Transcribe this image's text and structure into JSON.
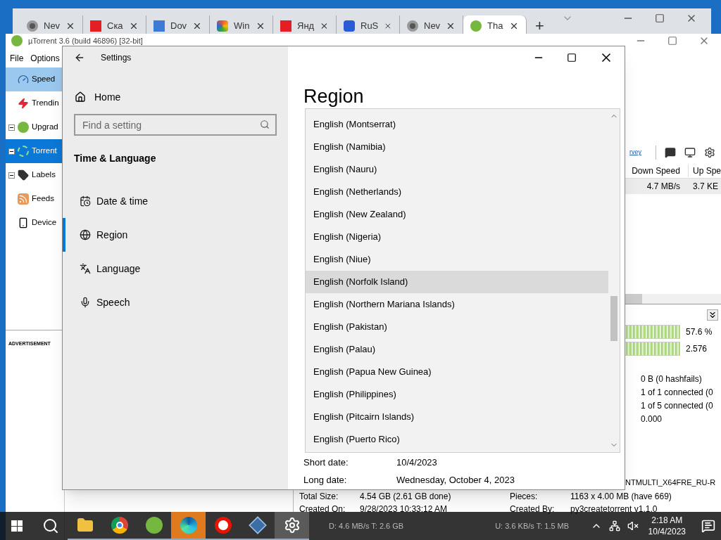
{
  "browser": {
    "tabs": [
      {
        "label": "Nev",
        "kind": "chrome",
        "selected": false
      },
      {
        "label": "Ска",
        "kind": "red",
        "selected": false
      },
      {
        "label": "Dov",
        "kind": "blue",
        "selected": false
      },
      {
        "label": "Win",
        "kind": "multi",
        "selected": false
      },
      {
        "label": "Янд",
        "kind": "red",
        "selected": false
      },
      {
        "label": "RuS",
        "kind": "navy",
        "selected": false
      },
      {
        "label": "Nev",
        "kind": "chrome",
        "selected": false
      },
      {
        "label": "Tha",
        "kind": "utorrent",
        "selected": true
      }
    ],
    "new_tab": "+"
  },
  "utorrent": {
    "title": "µTorrent 3.6  (build 46896) [32-bit]",
    "menu": [
      "File",
      "Options"
    ],
    "sidebar": [
      {
        "label": "Speed",
        "kind": "gauge",
        "expandable": false,
        "highlighted": true,
        "selected": false
      },
      {
        "label": "Trendin",
        "kind": "bolt",
        "expandable": false,
        "highlighted": false,
        "selected": false
      },
      {
        "label": "Upgrad",
        "kind": "utorrent",
        "expandable": true,
        "highlighted": false,
        "selected": false
      },
      {
        "label": "Torrent",
        "kind": "torrents",
        "expandable": true,
        "highlighted": false,
        "selected": true
      },
      {
        "label": "Labels",
        "kind": "tag",
        "expandable": true,
        "highlighted": false,
        "selected": false
      },
      {
        "label": "Feeds",
        "kind": "rss",
        "expandable": false,
        "highlighted": false,
        "selected": false
      },
      {
        "label": "Device",
        "kind": "phone",
        "expandable": false,
        "highlighted": false,
        "selected": false
      }
    ],
    "ad_label": "ADVERTISEMENT",
    "survey_link": "rvey",
    "columns": [
      "Down Speed",
      "Up Spe"
    ],
    "row": [
      "4.7 MB/s",
      "3.7 KE"
    ],
    "bars": [
      "57.6 %",
      "2.576"
    ],
    "info": [
      "0 B (0 hashfails)",
      "1 of 1 connected (0",
      "1 of 5 connected (0",
      "0.000"
    ],
    "file_name": "NTMULTI_X64FRE_RU-R",
    "details": [
      [
        "Total Size:",
        "4.54 GB (2.61 GB done)",
        "Pieces:",
        "1163 x 4.00 MB (have 669)"
      ],
      [
        "Created On:",
        "9/28/2023 10:33:12 AM",
        "Created By:",
        "py3createtorrent v1.1.0"
      ]
    ],
    "status": [
      "D: 4.6 MB/s T: 2.6 GB",
      "U: 3.6 KB/s T: 1.5 MB"
    ]
  },
  "settings": {
    "title": "Settings",
    "home": "Home",
    "search_placeholder": "Find a setting",
    "section": "Time & Language",
    "nav": [
      {
        "label": "Date & time",
        "kind": "calendar",
        "selected": false
      },
      {
        "label": "Region",
        "kind": "globe",
        "selected": true
      },
      {
        "label": "Language",
        "kind": "language",
        "selected": false
      },
      {
        "label": "Speech",
        "kind": "mic",
        "selected": false
      }
    ],
    "heading": "Region",
    "options": [
      {
        "label": "English (Montserrat)",
        "highlighted": false
      },
      {
        "label": "English (Namibia)",
        "highlighted": false
      },
      {
        "label": "English (Nauru)",
        "highlighted": false
      },
      {
        "label": "English (Netherlands)",
        "highlighted": false
      },
      {
        "label": "English (New Zealand)",
        "highlighted": false
      },
      {
        "label": "English (Nigeria)",
        "highlighted": false
      },
      {
        "label": "English (Niue)",
        "highlighted": false
      },
      {
        "label": "English (Norfolk Island)",
        "highlighted": true
      },
      {
        "label": "English (Northern Mariana Islands)",
        "highlighted": false
      },
      {
        "label": "English (Pakistan)",
        "highlighted": false
      },
      {
        "label": "English (Palau)",
        "highlighted": false
      },
      {
        "label": "English (Papua New Guinea)",
        "highlighted": false
      },
      {
        "label": "English (Philippines)",
        "highlighted": false
      },
      {
        "label": "English (Pitcairn Islands)",
        "highlighted": false
      },
      {
        "label": "English (Puerto Rico)",
        "highlighted": false
      }
    ],
    "formats": [
      [
        "Short date:",
        "10/4/2023"
      ],
      [
        "Long date:",
        "Wednesday, October 4, 2023"
      ]
    ]
  },
  "taskbar": {
    "apps": [
      {
        "kind": "explorer",
        "active": false,
        "running": true
      },
      {
        "kind": "chrome",
        "active": false,
        "running": true
      },
      {
        "kind": "utorrent",
        "active": false,
        "running": true
      },
      {
        "kind": "edge",
        "active": true,
        "running": true
      },
      {
        "kind": "yandex",
        "active": false,
        "running": true
      },
      {
        "kind": "vbox",
        "active": false,
        "running": true
      },
      {
        "kind": "settings",
        "active": false,
        "running": true,
        "focused": true
      }
    ],
    "time": "2:18 AM",
    "date": "10/4/2023"
  }
}
